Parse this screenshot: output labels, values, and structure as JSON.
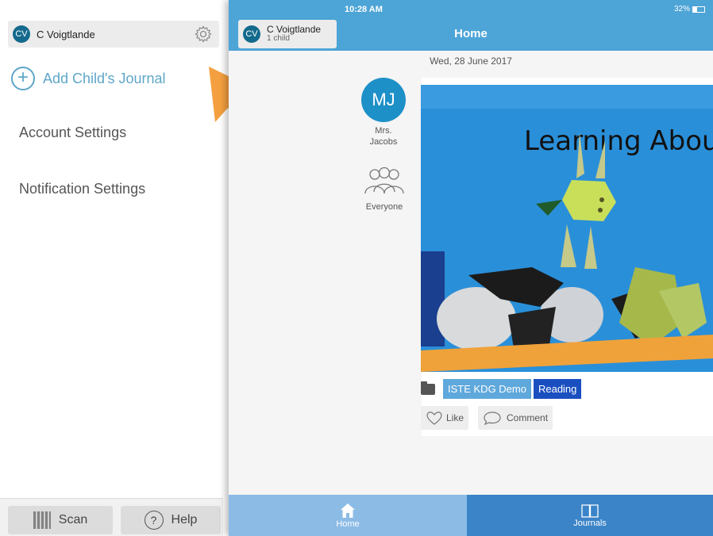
{
  "drawer": {
    "user_initials": "CV",
    "user_name": "C Voigtlande",
    "add_journal_label": "Add Child's Journal",
    "menu": [
      "Account Settings",
      "Notification Settings"
    ],
    "scan_label": "Scan",
    "help_label": "Help"
  },
  "status_bar": {
    "time": "10:28 AM",
    "battery": "32%"
  },
  "header": {
    "child_initials": "CV",
    "child_name": "C Voigtlande",
    "child_count": "1 child",
    "title": "Home"
  },
  "feed": {
    "date": "Wed, 28 June 2017",
    "post": {
      "author_initials": "MJ",
      "author_name_line1": "Mrs.",
      "author_name_line2": "Jacobs",
      "audience": "Everyone",
      "photo_text": "Learning About",
      "tags": [
        "ISTE KDG Demo",
        "Reading"
      ],
      "like_label": "Like",
      "comment_label": "Comment"
    }
  },
  "tabs": {
    "home": "Home",
    "journals": "Journals"
  },
  "colors": {
    "header": "#4da4d6",
    "arrow": "#f5a040",
    "tab_home": "#8cbbe6",
    "tab_journals": "#3b84c8"
  }
}
